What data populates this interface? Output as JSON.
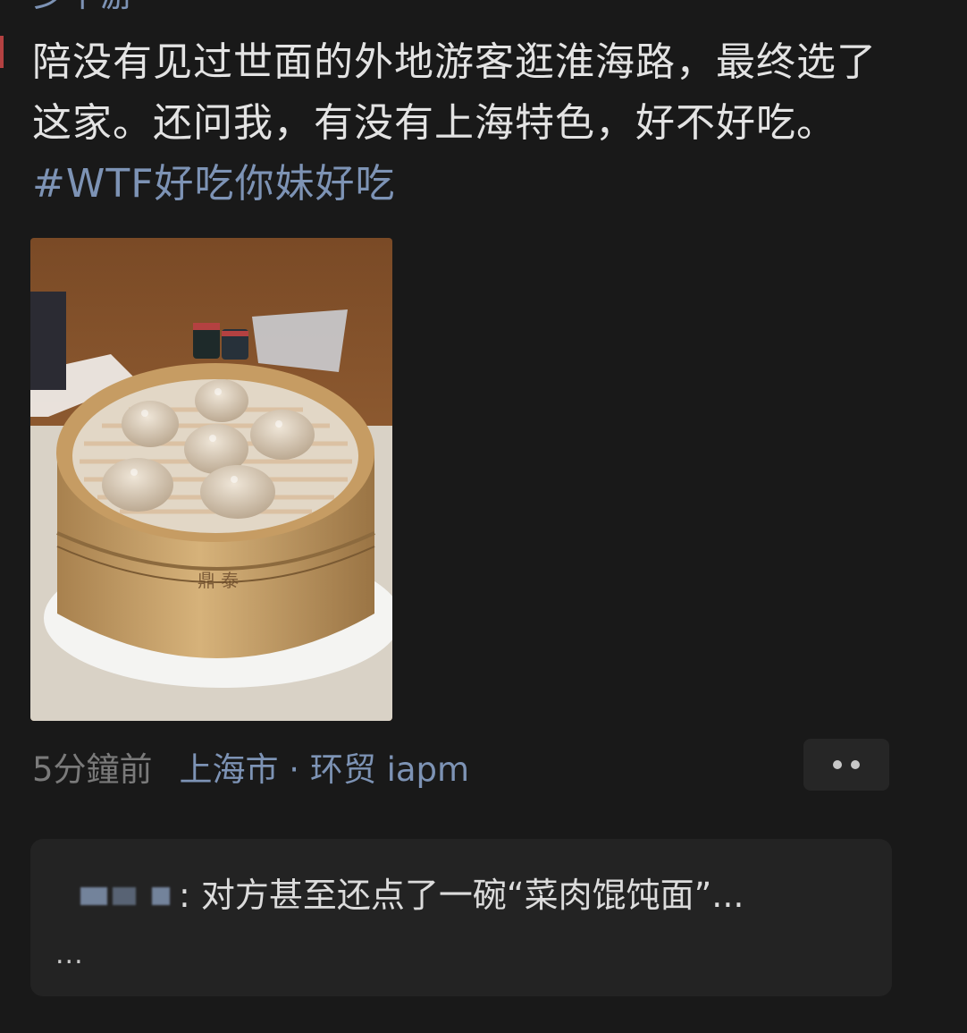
{
  "post": {
    "author_partial": "乡下游",
    "text": "陪没有见过世面的外地游客逛淮海路，最终选了这家。还问我，有没有上海特色，好不好吃。",
    "hashtag": "#WTF好吃你妹好吃",
    "time": "5分鐘前",
    "location": "上海市 · 环贸 iapm"
  },
  "photo": {
    "subject": "xiaolongbao-in-bamboo-steamer"
  },
  "actions": {
    "more_icon": "more-dots-icon"
  },
  "comment": {
    "text": ": 对方甚至还点了一碗“菜肉馄饨面”...",
    "more": "..."
  },
  "colors": {
    "background": "#191919",
    "text": "#e3e3e3",
    "link": "#7d93b5",
    "muted": "#7a7a7a",
    "card": "#232323"
  }
}
